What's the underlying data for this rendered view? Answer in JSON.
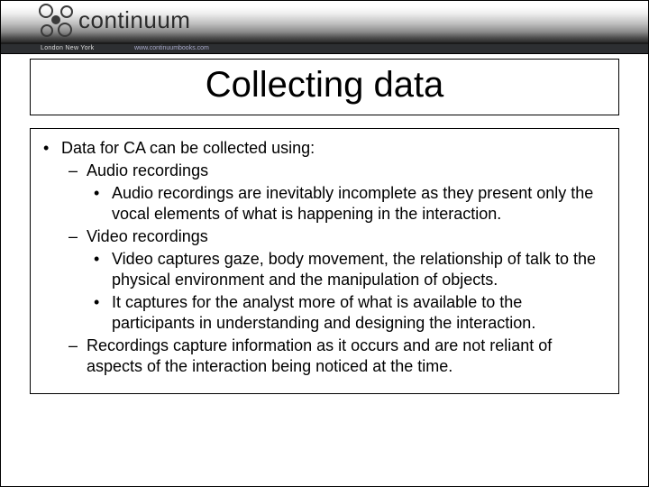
{
  "header": {
    "brand": "continuum",
    "cities": "London   New York",
    "url": "www.continuumbooks.com"
  },
  "title": "Collecting data",
  "content": {
    "l1_intro": "Data for CA can be collected using:",
    "audio_label": "Audio recordings",
    "audio_point1": "Audio recordings are inevitably incomplete as they present only the vocal elements of what is happening in the interaction.",
    "video_label": "Video recordings",
    "video_point1": "Video captures gaze, body movement, the relationship of talk to the physical environment and the manipulation of objects.",
    "video_point2": "It captures for the analyst more of what is available to the participants in understanding and designing the interaction.",
    "recordings_note": "Recordings capture information as it occurs and are not reliant of aspects of the interaction being noticed at the time."
  }
}
